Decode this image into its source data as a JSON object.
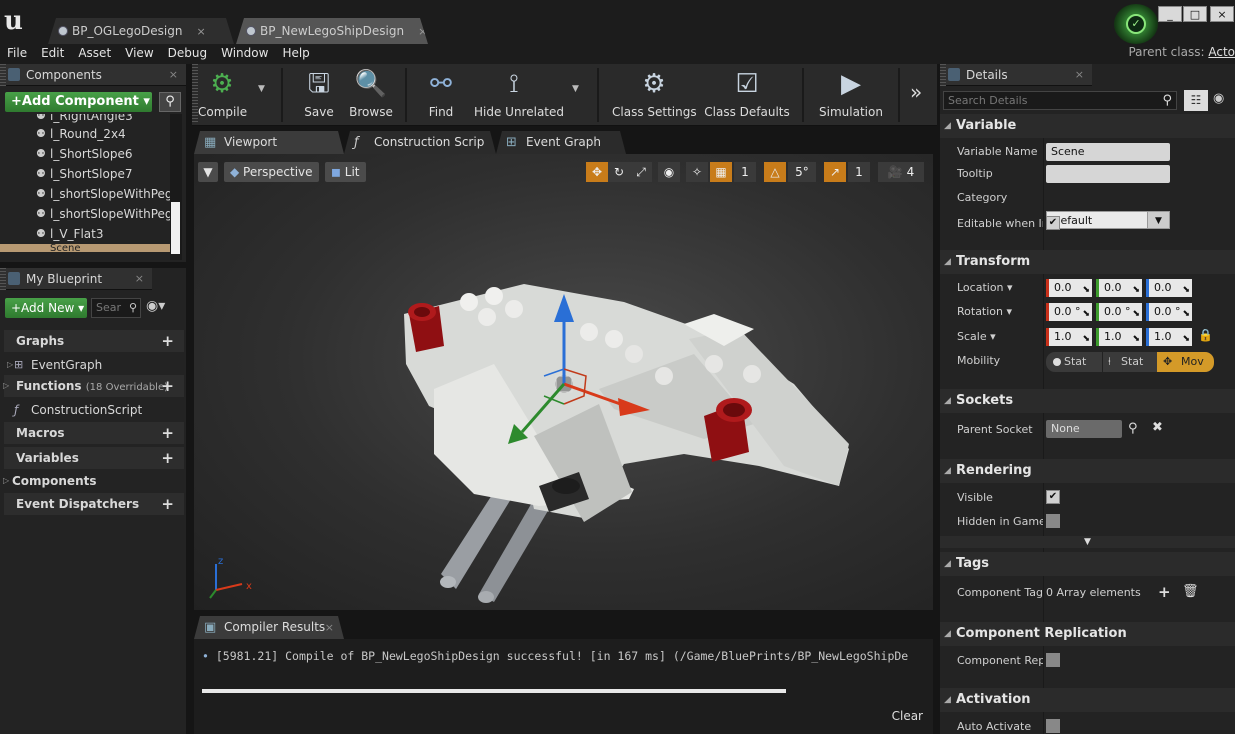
{
  "titlebar": {
    "tabs": [
      {
        "label": "BP_OGLegoDesign"
      },
      {
        "label": "BP_NewLegoShipDesign"
      }
    ],
    "close_glyph": "×",
    "win_buttons": [
      "_",
      "□",
      "×"
    ]
  },
  "menubar": {
    "items": [
      "File",
      "Edit",
      "Asset",
      "View",
      "Debug",
      "Window",
      "Help"
    ],
    "parent_class_label": "Parent class:",
    "parent_class_value": "Acto"
  },
  "components_panel": {
    "title": "Components",
    "add_button": "+Add Component ▾",
    "items": [
      "l_RightAngle3",
      "l_Round_2x4",
      "l_ShortSlope6",
      "l_ShortSlope7",
      "l_shortSlopeWithPeg6",
      "l_shortSlopeWithPeg7",
      "l_V_Flat3",
      "Scene"
    ]
  },
  "my_blueprint": {
    "title": "My Blueprint",
    "add_new": "+Add New ▾",
    "search_placeholder": "Sear",
    "sections": {
      "graphs": "Graphs",
      "event_graph": "EventGraph",
      "functions": "Functions",
      "functions_sub": "(18 Overridable)",
      "construction_script": "ConstructionScript",
      "macros": "Macros",
      "variables": "Variables",
      "components": "Components",
      "event_dispatchers": "Event Dispatchers"
    }
  },
  "toolbar": {
    "compile": "Compile",
    "save": "Save",
    "browse": "Browse",
    "find": "Find",
    "hide_unrelated": "Hide Unrelated",
    "class_settings": "Class Settings",
    "class_defaults": "Class Defaults",
    "simulation": "Simulation"
  },
  "editor_tabs": [
    "Viewport",
    "Construction Scrip",
    "Event Graph"
  ],
  "viewport": {
    "perspective": "Perspective",
    "lit": "Lit",
    "grid_snap": "1",
    "rot_snap": "5°",
    "scale_snap": "1",
    "cam_speed": "4"
  },
  "compiler": {
    "title": "Compiler Results",
    "log": "[5981.21] Compile of BP_NewLegoShipDesign successful! [in 167 ms] (/Game/BluePrints/BP_NewLegoShipDe",
    "clear": "Clear"
  },
  "details": {
    "title": "Details",
    "search_placeholder": "Search Details",
    "variable": {
      "header": "Variable",
      "name_label": "Variable Name",
      "name_value": "Scene",
      "tooltip_label": "Tooltip",
      "tooltip_value": "",
      "category_label": "Category",
      "category_value": "Default",
      "editable_label": "Editable when Inh",
      "editable_checked": true
    },
    "transform": {
      "header": "Transform",
      "location_label": "Location ▾",
      "location": [
        "0.0",
        "0.0",
        "0.0"
      ],
      "rotation_label": "Rotation ▾",
      "rotation": [
        "0.0 °",
        "0.0 °",
        "0.0 °"
      ],
      "scale_label": "Scale ▾",
      "scale": [
        "1.0",
        "1.0",
        "1.0"
      ],
      "mobility_label": "Mobility",
      "mobility": [
        "Stat",
        "Stat",
        "Mov"
      ]
    },
    "sockets": {
      "header": "Sockets",
      "parent_socket_label": "Parent Socket",
      "parent_socket_value": "None"
    },
    "rendering": {
      "header": "Rendering",
      "visible_label": "Visible",
      "visible_checked": true,
      "hidden_label": "Hidden in Game",
      "hidden_checked": false
    },
    "tags": {
      "header": "Tags",
      "component_tags_label": "Component Tags",
      "component_tags_value": "0 Array elements"
    },
    "replication": {
      "header": "Component Replication",
      "label": "Component Repli"
    },
    "activation": {
      "header": "Activation",
      "label": "Auto Activate"
    }
  },
  "colors": {
    "accent_green": "#3f8f3f",
    "axis_x": "#d83a1a",
    "axis_y": "#2d8a2d",
    "axis_z": "#2a6fd6",
    "active_snap": "#c87c1a"
  }
}
